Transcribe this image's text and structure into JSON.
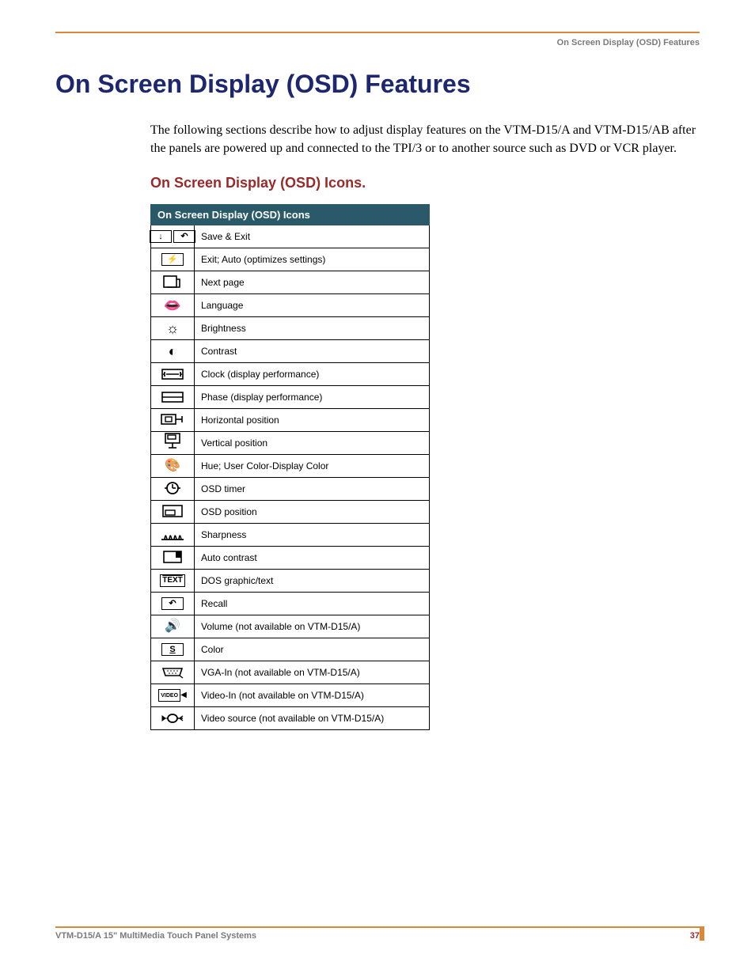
{
  "header": {
    "label": "On Screen Display (OSD) Features"
  },
  "title": "On Screen Display (OSD) Features",
  "intro": "The following sections describe how to adjust display features on the VTM-D15/A and VTM-D15/AB after the panels are powered up and connected to the TPI/3 or to another source such as DVD or VCR player.",
  "subtitle": "On Screen Display (OSD) Icons.",
  "table": {
    "header": "On Screen Display (OSD) Icons",
    "rows": [
      {
        "icon": "save-exit-icon",
        "desc": "Save & Exit"
      },
      {
        "icon": "exit-auto-icon",
        "desc": "Exit; Auto (optimizes settings)"
      },
      {
        "icon": "next-page-icon",
        "desc": "Next page"
      },
      {
        "icon": "language-icon",
        "desc": "Language"
      },
      {
        "icon": "brightness-icon",
        "desc": "Brightness"
      },
      {
        "icon": "contrast-icon",
        "desc": "Contrast"
      },
      {
        "icon": "clock-icon",
        "desc": "Clock (display performance)"
      },
      {
        "icon": "phase-icon",
        "desc": "Phase (display performance)"
      },
      {
        "icon": "horizontal-position-icon",
        "desc": "Horizontal position"
      },
      {
        "icon": "vertical-position-icon",
        "desc": "Vertical position"
      },
      {
        "icon": "hue-icon",
        "desc": "Hue; User Color-Display Color"
      },
      {
        "icon": "osd-timer-icon",
        "desc": "OSD timer"
      },
      {
        "icon": "osd-position-icon",
        "desc": "OSD position"
      },
      {
        "icon": "sharpness-icon",
        "desc": "Sharpness"
      },
      {
        "icon": "auto-contrast-icon",
        "desc": "Auto contrast"
      },
      {
        "icon": "dos-text-icon",
        "desc": "DOS graphic/text"
      },
      {
        "icon": "recall-icon",
        "desc": "Recall"
      },
      {
        "icon": "volume-icon",
        "desc": "Volume (not available on VTM-D15/A)"
      },
      {
        "icon": "color-icon",
        "desc": "Color"
      },
      {
        "icon": "vga-in-icon",
        "desc": "VGA-In (not available on VTM-D15/A)"
      },
      {
        "icon": "video-in-icon",
        "desc": "Video-In (not available on VTM-D15/A)"
      },
      {
        "icon": "video-source-icon",
        "desc": "Video source (not available on VTM-D15/A)"
      }
    ]
  },
  "footer": {
    "left": "VTM-D15/A 15\" MultiMedia Touch Panel Systems",
    "page": "37"
  }
}
